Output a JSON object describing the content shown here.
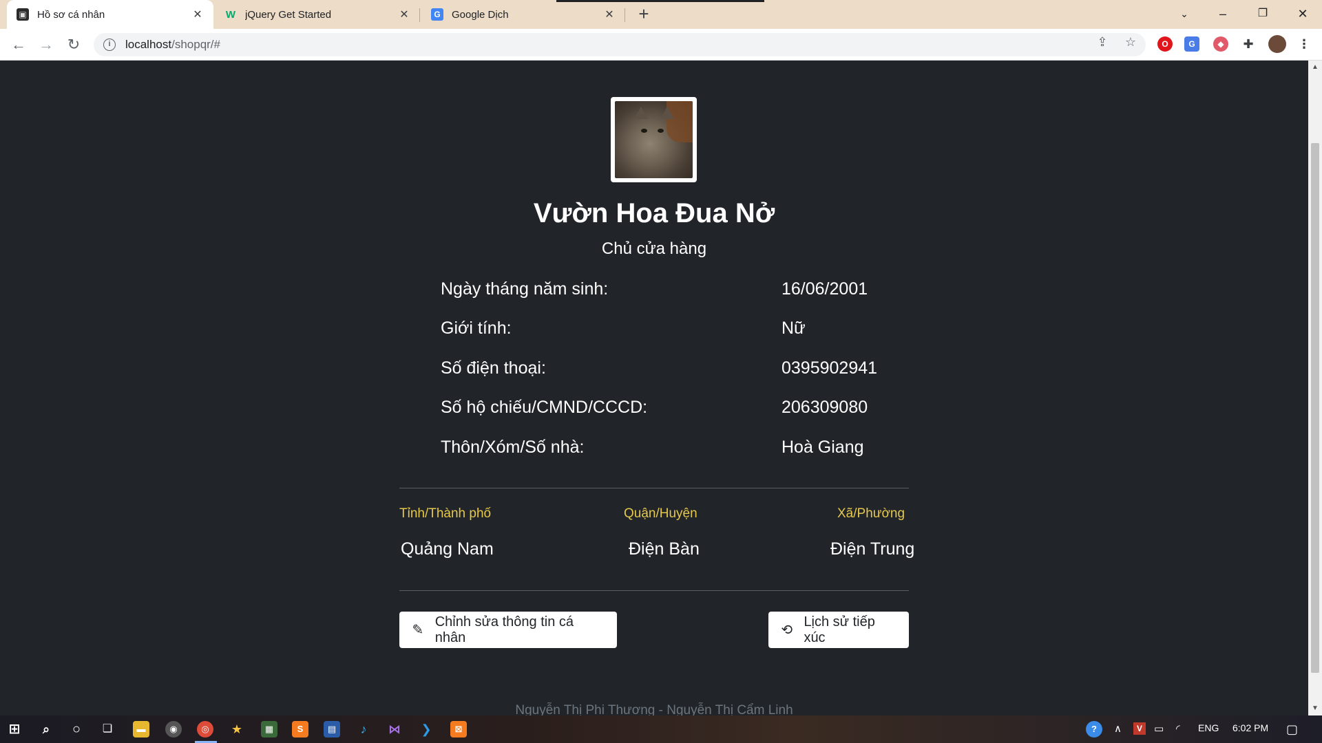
{
  "browser": {
    "tabs": [
      {
        "title": "Hồ sơ cá nhân",
        "favicon": "shopqr-favicon",
        "active": true
      },
      {
        "title": "jQuery Get Started",
        "favicon": "w3schools-favicon",
        "active": false
      },
      {
        "title": "Google Dịch",
        "favicon": "google-translate-favicon",
        "active": false
      }
    ],
    "url_host": "localhost",
    "url_path": "/shopqr/#"
  },
  "profile": {
    "name": "Vườn Hoa Đua Nở",
    "role": "Chủ cửa hàng",
    "fields": [
      {
        "label": "Ngày tháng năm sinh:",
        "value": "16/06/2001"
      },
      {
        "label": "Giới tính:",
        "value": "Nữ"
      },
      {
        "label": "Số điện thoại:",
        "value": "0395902941"
      },
      {
        "label": "Số hộ chiếu/CMND/CCCD:",
        "value": "206309080"
      },
      {
        "label": "Thôn/Xóm/Số nhà:",
        "value": "Hoà Giang"
      }
    ],
    "location": {
      "province_label": "Tỉnh/Thành phố",
      "province": "Quảng Nam",
      "district_label": "Quận/Huyện",
      "district": "Điện Bàn",
      "ward_label": "Xã/Phường",
      "ward": "Điện Trung"
    },
    "buttons": {
      "edit": "Chỉnh sửa thông tin cá nhân",
      "history": "Lịch sử tiếp xúc"
    }
  },
  "footer": {
    "authors": "Nguyễn Thị Phi Thương - Nguyễn Thị Cẩm Linh"
  },
  "taskbar": {
    "language": "ENG",
    "time": "6:02 PM"
  },
  "colors": {
    "page_bg": "#212529",
    "accent_label": "#e6c84a",
    "tab_strip": "#ecdcc8"
  }
}
